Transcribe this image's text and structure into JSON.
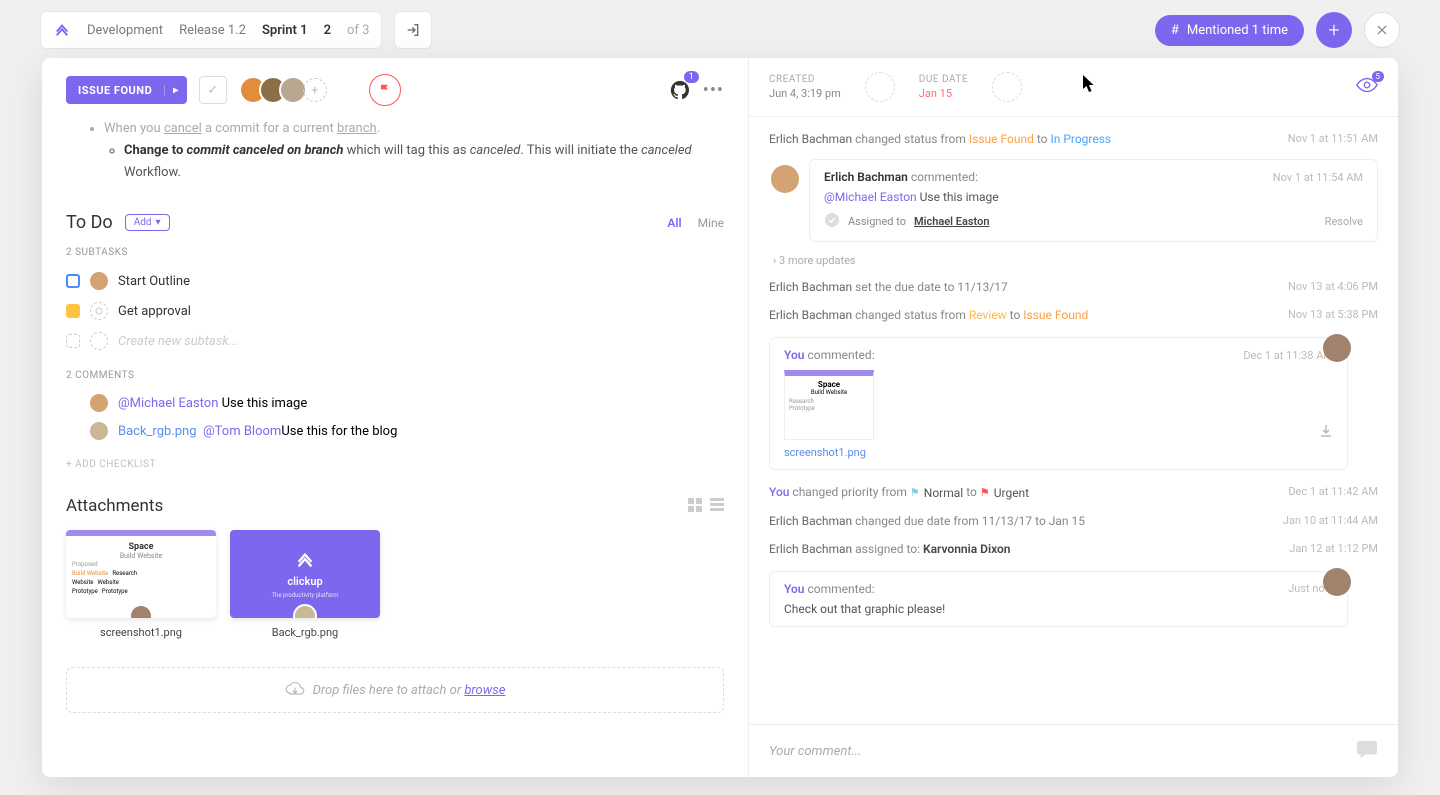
{
  "breadcrumb": {
    "space": "Development",
    "release": "Release 1.2",
    "sprint": "Sprint 1",
    "index": "2",
    "of": "of 3"
  },
  "topbar": {
    "mentioned": "Mentioned 1 time"
  },
  "header": {
    "status_label": "ISSUE FOUND",
    "github_badge": "1",
    "watch_badge": "5"
  },
  "meta": {
    "created_label": "CREATED",
    "created_value": "Jun 4, 3:19 pm",
    "due_label": "DUE DATE",
    "due_value": "Jan 15"
  },
  "description": {
    "line1_prefix": "When you ",
    "line1_cancel": "cancel",
    "line1_mid": " a commit for a current ",
    "line1_branch": "branch",
    "line1_end": ".",
    "line2_prefix": "Change to ",
    "line2_em": "commit canceled on branch",
    "line2_mid": " which will tag this as ",
    "line2_canceled": "canceled",
    "line2_mid2": ". This will initiate the ",
    "line2_canceled2": "canceled",
    "line2_end": " Workflow."
  },
  "todo": {
    "title": "To Do",
    "add": "Add",
    "all": "All",
    "mine": "Mine",
    "subtasks_heading": "2 SUBTASKS",
    "items": [
      {
        "label": "Start Outline"
      },
      {
        "label": "Get approval"
      }
    ],
    "new_placeholder": "Create new subtask...",
    "comments_heading": "2 COMMENTS",
    "comments": [
      {
        "mention": "@Michael Easton",
        "text": " Use this image"
      },
      {
        "file": "Back_rgb.png",
        "mention": "@Tom Bloom",
        "text": "Use this for the blog"
      }
    ],
    "add_checklist": "+ ADD CHECKLIST"
  },
  "attachments": {
    "title": "Attachments",
    "items": [
      {
        "name": "screenshot1.png"
      },
      {
        "name": "Back_rgb.png"
      }
    ],
    "thumb1": {
      "title": "Space",
      "sub": "Build Website",
      "tag_proposed": "Proposed",
      "row_research": "Research",
      "row_build": "Build Website",
      "row_website": "Website",
      "row_proto": "Prototype"
    },
    "thumb2": {
      "brand": "clickup",
      "tag": "The productivity platform"
    },
    "drop_text": "Drop files here to attach or ",
    "drop_browse": "browse"
  },
  "activity": {
    "row1": {
      "who": "Erlich Bachman",
      "mid": " changed status from ",
      "from": "Issue Found",
      "to_word": " to ",
      "to": "In Progress",
      "time": "Nov 1 at 11:51 AM"
    },
    "comment1": {
      "author": "Erlich Bachman",
      "said": "commented:",
      "time": "Nov 1 at 11:54 AM",
      "mention": "@Michael Easton",
      "body": " Use this image",
      "assigned_label": "Assigned to ",
      "assigned_to": "Michael Easton",
      "resolve": "Resolve"
    },
    "more": "› 3 more updates",
    "row2": {
      "who": "Erlich Bachman",
      "mid": " set the due date to 11/13/17",
      "time": "Nov 13 at 4:06 PM"
    },
    "row3": {
      "who": "Erlich Bachman",
      "mid": " changed status from ",
      "from": "Review",
      "to_word": " to ",
      "to": "Issue Found",
      "time": "Nov 13 at 5:38 PM"
    },
    "comment2": {
      "author": "You",
      "said": "commented:",
      "time": "Dec 1 at 11:38 AM",
      "file": "screenshot1.png"
    },
    "row4": {
      "who": "You",
      "mid": " changed priority from ",
      "from": "Normal",
      "to_word": " to ",
      "to": "Urgent",
      "time": "Dec 1 at 11:42 AM"
    },
    "row5": {
      "who": "Erlich Bachman",
      "mid": " changed due date from 11/13/17 to Jan 15",
      "time": "Jan 10 at 11:44 AM"
    },
    "row6": {
      "who": "Erlich Bachman",
      "mid": " assigned to: ",
      "to": "Karvonnia Dixon",
      "time": "Jan 12 at 1:12 PM"
    },
    "comment3": {
      "author": "You",
      "said": "commented:",
      "time": "Just now",
      "body": "Check out that graphic please!"
    }
  },
  "comment_input": {
    "placeholder": "Your comment..."
  }
}
